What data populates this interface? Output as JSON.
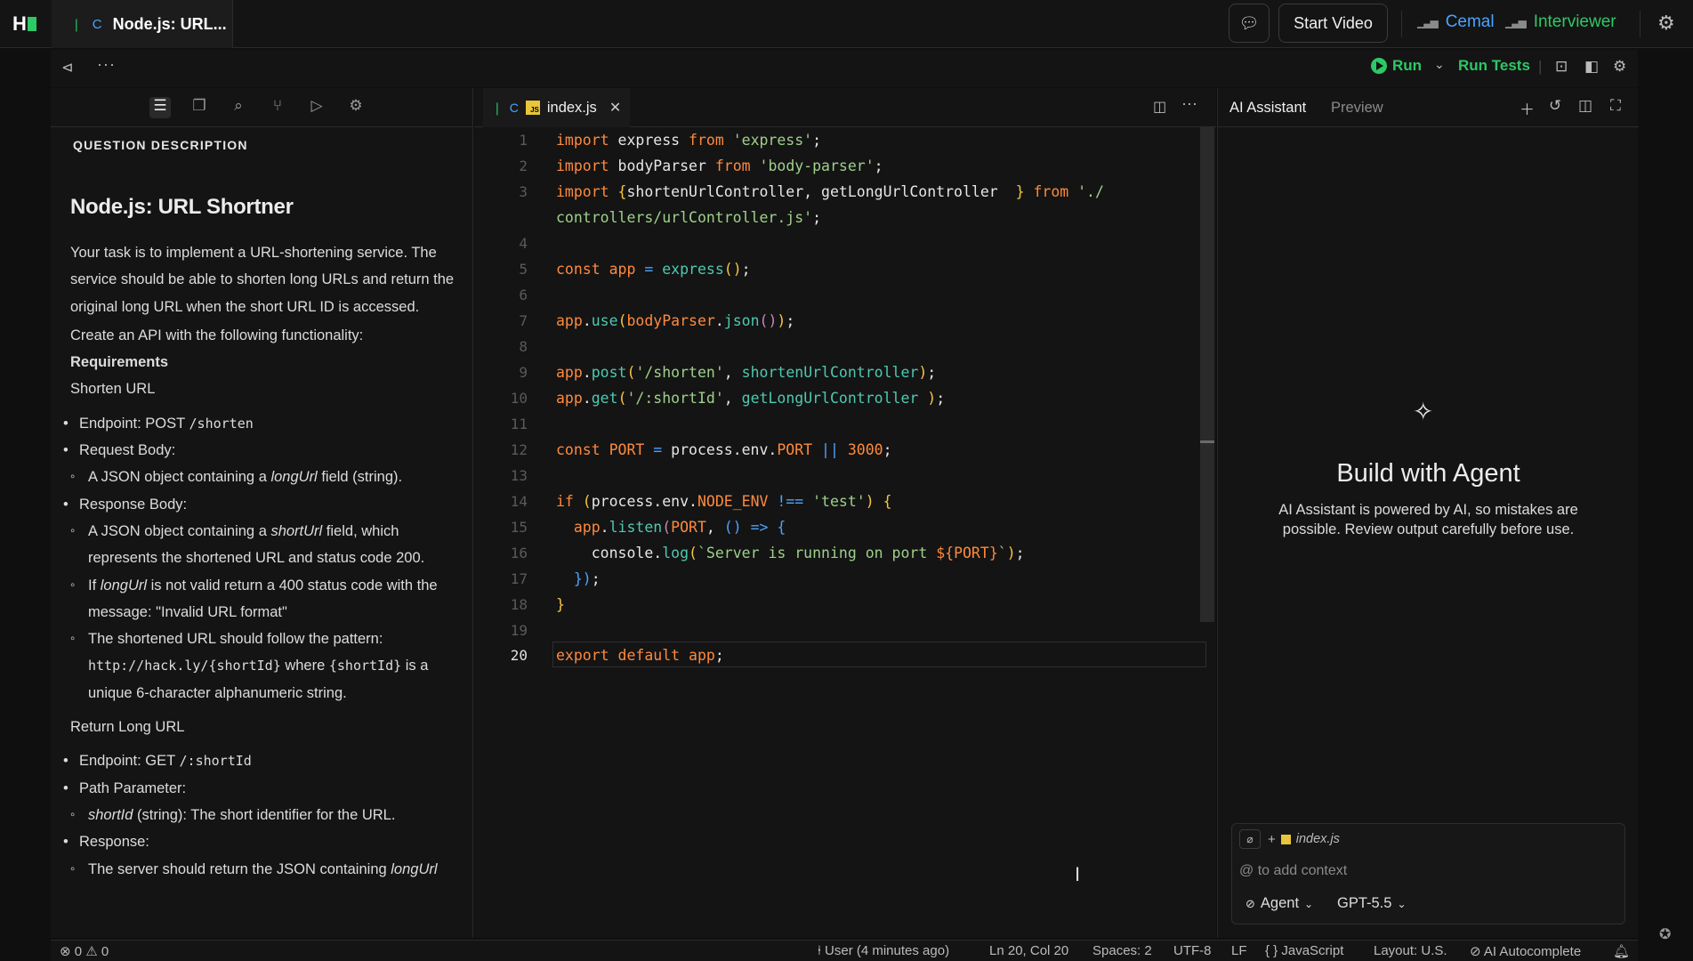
{
  "topbar": {
    "tab_title": "Node.js: URL...",
    "start_video": "Start Video",
    "participants": [
      {
        "name": "Cemal",
        "color": "#4aa3ff"
      },
      {
        "name": "Interviewer",
        "color": "#2ec866"
      }
    ]
  },
  "toolbar": {
    "run": "Run",
    "run_tests": "Run Tests"
  },
  "question": {
    "section_label": "QUESTION DESCRIPTION",
    "title": "Node.js: URL Shortner",
    "intro": "Your task is to implement a URL-shortening service. The service should be able to shorten long URLs and return the original long URL when the short URL ID is accessed.",
    "create_api": "Create an API with the following functionality:",
    "requirements": "Requirements",
    "shorten_heading": "Shorten URL",
    "endpoint1_label": "Endpoint: POST ",
    "endpoint1_code": "/shorten",
    "request_body": "Request Body:",
    "req_item_pre": "A JSON object containing a ",
    "req_item_em": "longUrl",
    "req_item_post": " field (string).",
    "response_body": "Response Body:",
    "resp1_pre": "A JSON object containing a ",
    "resp1_em": "shortUrl",
    "resp1_post": " field, which represents the shortened URL and status code 200.",
    "resp2_pre": "If ",
    "resp2_em": "longUrl",
    "resp2_post": " is not valid return a 400 status code with the message: \"Invalid URL format\"",
    "resp3_pre": "The shortened URL should follow the pattern: ",
    "resp3_code1": "http://hack.ly/{shortId}",
    "resp3_mid": " where ",
    "resp3_code2": "{shortId}",
    "resp3_post": " is a unique 6-character alphanumeric string.",
    "return_heading": "Return Long URL",
    "endpoint2_label": "Endpoint: GET ",
    "endpoint2_code": "/:shortId",
    "path_param": "Path Parameter:",
    "path_item_em": "shortId",
    "path_item_post": " (string): The short identifier for the URL.",
    "response": "Response:",
    "resp_item_pre": "The server should return the JSON containing ",
    "resp_item_em": "longUrl"
  },
  "editor": {
    "file_name": "index.js",
    "line_numbers": [
      "1",
      "2",
      "3",
      "4",
      "5",
      "6",
      "7",
      "8",
      "9",
      "10",
      "11",
      "12",
      "13",
      "14",
      "15",
      "16",
      "17",
      "18",
      "19",
      "20"
    ],
    "code": {
      "l1_a": "import",
      "l1_b": " express ",
      "l1_c": "from",
      "l1_d": " 'express'",
      "l1_e": ";",
      "l2_a": "import",
      "l2_b": " bodyParser ",
      "l2_c": "from",
      "l2_d": " 'body-parser'",
      "l2_e": ";",
      "l3_a": "import",
      "l3_b": " {",
      "l3_c": "shortenUrlController, getLongUrlController  ",
      "l3_d": "}",
      "l3_e": " from",
      "l3_f": " './",
      "l3b_a": "controllers/urlController.js'",
      "l3b_b": ";",
      "l5_a": "const",
      "l5_b": " app",
      "l5_c": " = ",
      "l5_d": "express",
      "l5_e": "()",
      "l5_f": ";",
      "l7_a": "app",
      "l7_b": ".",
      "l7_c": "use",
      "l7_d": "(",
      "l7_e": "bodyParser",
      "l7_f": ".",
      "l7_g": "json",
      "l7_h": "()",
      "l7_i": ")",
      "l7_j": ";",
      "l9_a": "app",
      "l9_b": ".",
      "l9_c": "post",
      "l9_d": "(",
      "l9_e": "'/shorten'",
      "l9_f": ", ",
      "l9_g": "shortenUrlController",
      "l9_h": ")",
      "l9_i": ";",
      "l10_a": "app",
      "l10_b": ".",
      "l10_c": "get",
      "l10_d": "(",
      "l10_e": "'/:shortId'",
      "l10_f": ", ",
      "l10_g": "getLongUrlController ",
      "l10_h": ")",
      "l10_i": ";",
      "l12_a": "const",
      "l12_b": " PORT",
      "l12_c": " = ",
      "l12_d": "process.env.",
      "l12_e": "PORT",
      "l12_f": " || ",
      "l12_g": "3000",
      "l12_h": ";",
      "l14_a": "if",
      "l14_b": " (",
      "l14_c": "process.env.",
      "l14_d": "NODE_ENV",
      "l14_e": " !== ",
      "l14_f": "'test'",
      "l14_g": ") ",
      "l14_h": "{",
      "l15_a": "  app",
      "l15_b": ".",
      "l15_c": "listen",
      "l15_d": "(",
      "l15_e": "PORT",
      "l15_f": ", ",
      "l15_g": "() => {",
      "l16_a": "    console",
      "l16_b": ".",
      "l16_c": "log",
      "l16_d": "(",
      "l16_e": "`Server is running on port ",
      "l16_f": "${",
      "l16_g": "PORT",
      "l16_h": "}",
      "l16_i": "`",
      "l16_j": ")",
      "l16_k": ";",
      "l17_a": "  })",
      "l17_b": ";",
      "l18_a": "}",
      "l20_a": "export",
      "l20_b": " default",
      "l20_c": " app",
      "l20_d": ";"
    }
  },
  "ai": {
    "tab_assistant": "AI Assistant",
    "tab_preview": "Preview",
    "title": "Build with Agent",
    "description": "AI Assistant is powered by AI, so mistakes are possible. Review output carefully before use.",
    "context_file": "index.js",
    "context_placeholder": "@ to add context",
    "mode": "Agent",
    "model": "GPT-5.5"
  },
  "status": {
    "errors": "0",
    "warnings": "0",
    "user": "User (4 minutes ago)",
    "position": "Ln 20, Col 20",
    "spaces": "Spaces: 2",
    "encoding": "UTF-8",
    "eol": "LF",
    "language": "JavaScript",
    "layout": "Layout: U.S.",
    "autocomplete": "AI Autocomplete"
  },
  "colors": {
    "accent_green": "#2ec866",
    "accent_blue": "#4aa3ff",
    "keyword_orange": "#ff8a3d",
    "string_green": "#9fd08a"
  }
}
